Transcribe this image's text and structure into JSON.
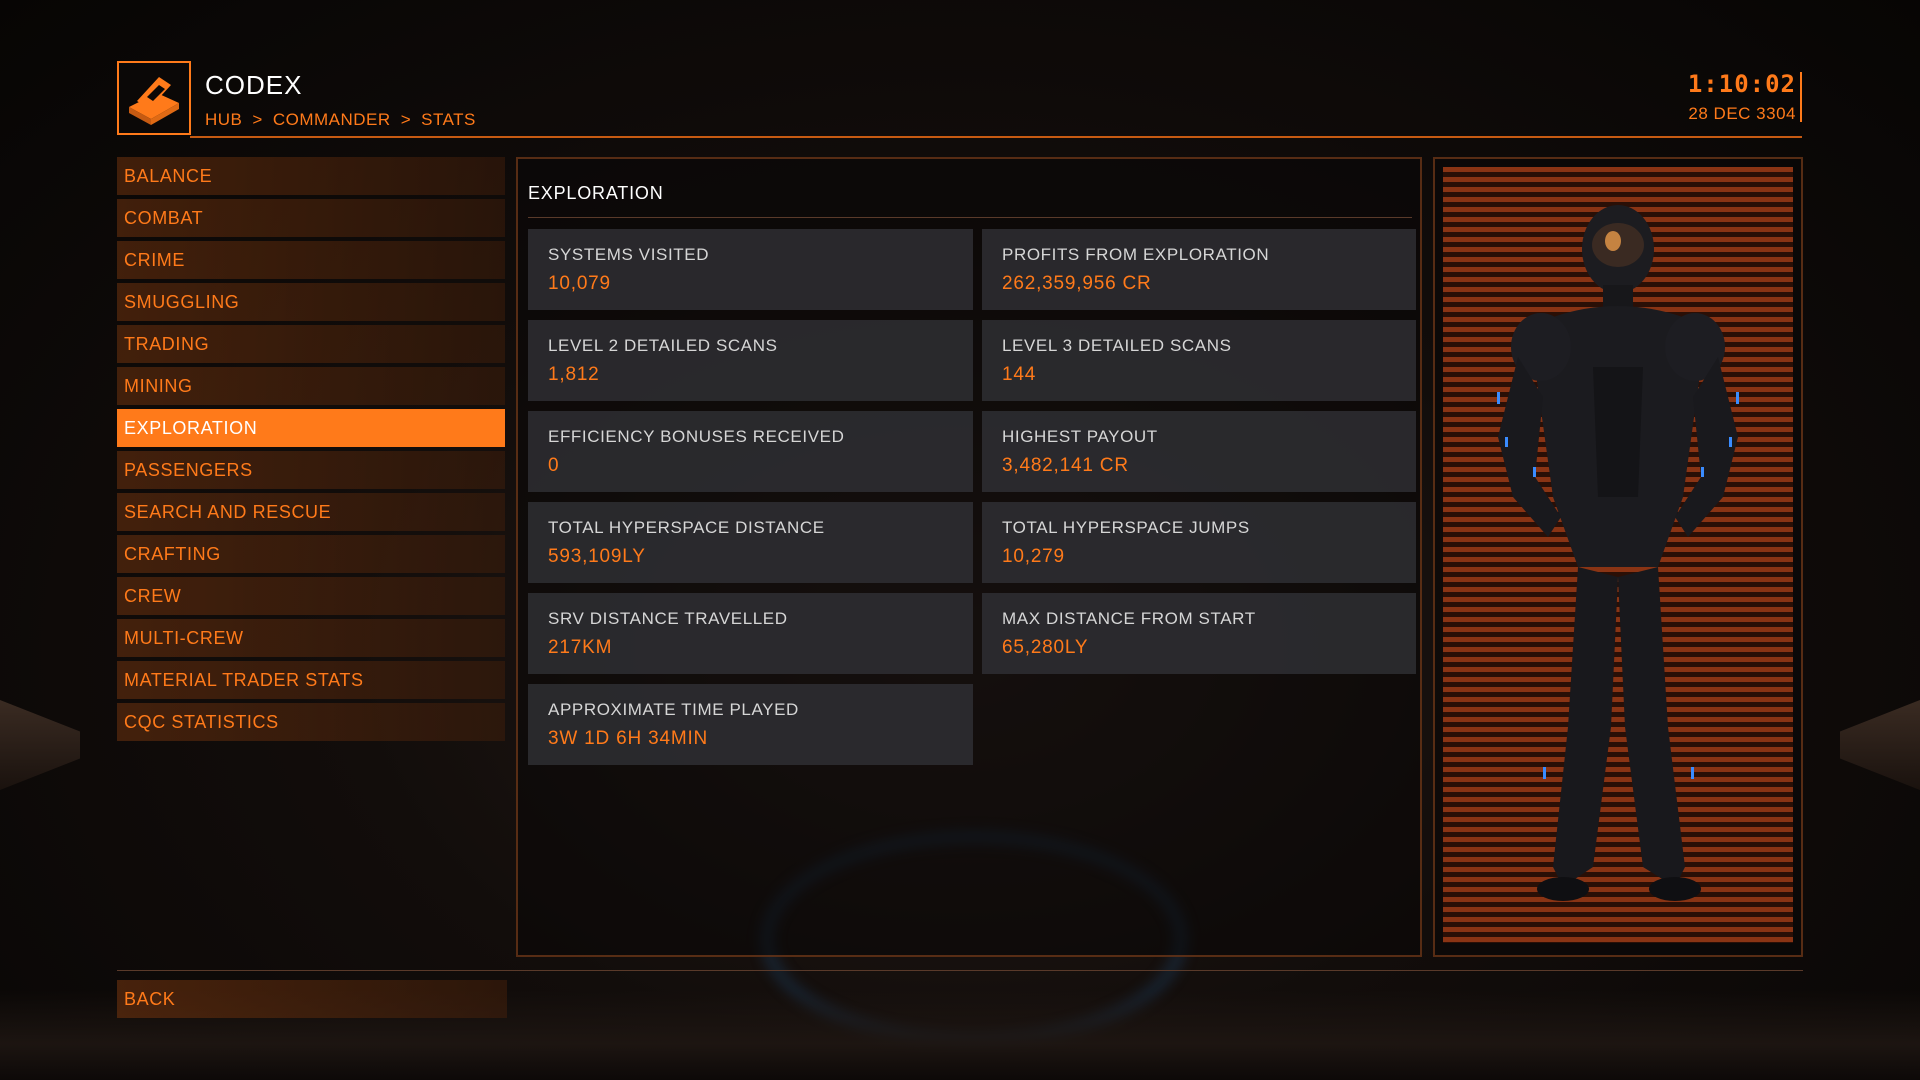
{
  "header": {
    "title": "CODEX",
    "breadcrumb": [
      "HUB",
      ">",
      "COMMANDER",
      ">",
      "STATS"
    ],
    "time": "1:10:02",
    "date": "28 DEC 3304"
  },
  "sidebar": {
    "items": [
      {
        "label": "BALANCE"
      },
      {
        "label": "COMBAT"
      },
      {
        "label": "CRIME"
      },
      {
        "label": "SMUGGLING"
      },
      {
        "label": "TRADING"
      },
      {
        "label": "MINING"
      },
      {
        "label": "EXPLORATION",
        "active": true
      },
      {
        "label": "PASSENGERS"
      },
      {
        "label": "SEARCH AND RESCUE"
      },
      {
        "label": "CRAFTING"
      },
      {
        "label": "CREW"
      },
      {
        "label": "MULTI-CREW"
      },
      {
        "label": "MATERIAL TRADER STATS"
      },
      {
        "label": "CQC STATISTICS"
      }
    ]
  },
  "main": {
    "title": "EXPLORATION",
    "stats": [
      {
        "label": "SYSTEMS VISITED",
        "value": "10,079"
      },
      {
        "label": "PROFITS FROM EXPLORATION",
        "value": "262,359,956 CR"
      },
      {
        "label": "LEVEL 2 DETAILED SCANS",
        "value": "1,812"
      },
      {
        "label": "LEVEL 3 DETAILED SCANS",
        "value": "144"
      },
      {
        "label": "EFFICIENCY BONUSES RECEIVED",
        "value": "0"
      },
      {
        "label": "HIGHEST PAYOUT",
        "value": "3,482,141 CR"
      },
      {
        "label": "TOTAL HYPERSPACE DISTANCE",
        "value": "593,109LY"
      },
      {
        "label": "TOTAL HYPERSPACE JUMPS",
        "value": "10,279"
      },
      {
        "label": "SRV DISTANCE TRAVELLED",
        "value": "217KM"
      },
      {
        "label": "MAX DISTANCE FROM START",
        "value": "65,280LY"
      },
      {
        "label": "APPROXIMATE TIME PLAYED",
        "value": "3W 1D 6H 34MIN"
      }
    ]
  },
  "footer": {
    "back_label": "BACK"
  },
  "colors": {
    "accent": "#ff7a1a",
    "card_bg": "#303034",
    "portrait_stripe": "#8a3414"
  },
  "icons": {
    "logo": "codex-book-icon"
  }
}
